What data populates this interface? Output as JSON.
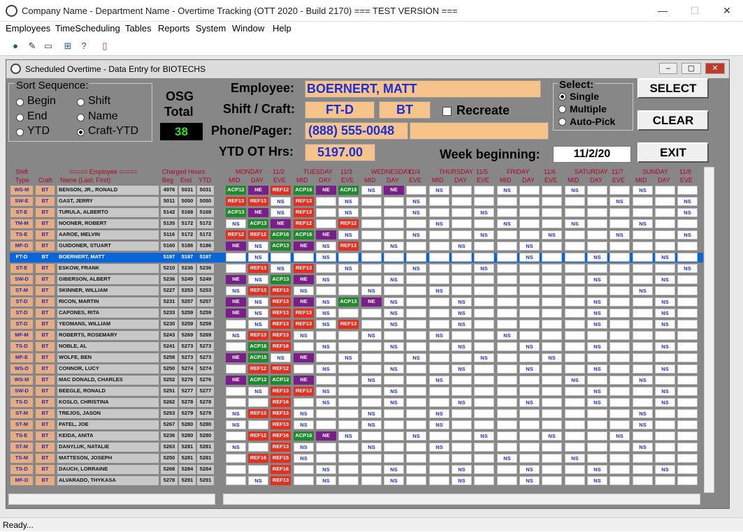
{
  "window": {
    "title": "Company Name - Department Name - Overtime Tracking (OTT 2020 - Build 2170)  === TEST VERSION ===",
    "min": "—",
    "max": "☐",
    "close": "✕"
  },
  "menu": [
    "Employees",
    "TimeScheduling",
    "Tables",
    "Reports",
    "System",
    "Window",
    "Help"
  ],
  "toolbar": [
    "db-icon",
    "pencil-icon",
    "print-icon",
    "grid-icon",
    "help-icon",
    "exit-door-icon"
  ],
  "child": {
    "title": "Scheduled Overtime - Data Entry for BIOTECHS"
  },
  "sort": {
    "title": "Sort Sequence:",
    "options": [
      "Begin",
      "Shift",
      "End",
      "Name",
      "YTD",
      "Craft-YTD"
    ],
    "selected": "Craft-YTD"
  },
  "osg": {
    "label1": "OSG",
    "label2": "Total",
    "value": "38"
  },
  "employee": {
    "label": "Employee:",
    "value": "BOERNERT, MATT"
  },
  "shift": {
    "label": "Shift / Craft:",
    "shift": "FT-D",
    "craft": "BT",
    "recreate": "Recreate"
  },
  "phone": {
    "label": "Phone/Pager:",
    "value": "(888) 555-0048",
    "pager": ""
  },
  "ytd": {
    "label": "YTD OT Hrs:",
    "value": "5197.00"
  },
  "week": {
    "label": "Week beginning:",
    "value": "11/2/20"
  },
  "select": {
    "title": "Select:",
    "options": [
      "Single",
      "Multiple",
      "Auto-Pick"
    ],
    "selected": "Single"
  },
  "buttons": {
    "select": "SELECT",
    "clear": "CLEAR",
    "exit": "EXIT"
  },
  "grid": {
    "hdr": {
      "shift": "Shift",
      "type": "Type",
      "craft": "Craft",
      "emp": "===== Employee =====",
      "name": "Name (Last, First)",
      "charged": "Charged Hours",
      "beg": "Beg",
      "end": "End",
      "ytd": "YTD"
    },
    "days": [
      {
        "d": "MONDAY",
        "dt": "11/2"
      },
      {
        "d": "TUESDAY",
        "dt": "11/3"
      },
      {
        "d": "WEDNESDAY",
        "dt": "11/4"
      },
      {
        "d": "THURSDAY",
        "dt": "11/5"
      },
      {
        "d": "FRIDAY",
        "dt": "11/6"
      },
      {
        "d": "SATURDAY",
        "dt": "11/7"
      },
      {
        "d": "SUNDAY",
        "dt": "11/8"
      }
    ],
    "sub": [
      "MID",
      "DAY",
      "EVE"
    ],
    "rows": [
      [
        "WS-M",
        "BT",
        "BENSON, JR., RONALD",
        "4976",
        "5031",
        "5031",
        "ACP12",
        "NE",
        "REF12",
        "ACP16",
        "NE",
        "ACP15",
        "NS",
        "NE",
        "",
        "NS",
        "",
        "",
        "NS",
        "",
        "",
        "NS",
        "",
        "",
        "NS",
        "",
        ""
      ],
      [
        "SW-E",
        "BT",
        "GAST, JERRY",
        "5011",
        "5050",
        "5050",
        "REF13",
        "REF13",
        "NS",
        "REF13",
        "",
        "NS",
        "",
        "",
        "NS",
        "",
        "",
        "",
        "",
        "",
        "",
        "",
        "",
        "NS",
        "",
        "",
        "NS"
      ],
      [
        "ST-E",
        "BT",
        "TURULA, ALBERTO",
        "5142",
        "5168",
        "5168",
        "ACP13",
        "NE",
        "NS",
        "REF13",
        "",
        "NS",
        "",
        "",
        "NS",
        "",
        "",
        "NS",
        "",
        "",
        "",
        "",
        "",
        "",
        "",
        "",
        "NS"
      ],
      [
        "TM-M",
        "BT",
        "NOONER, ROBERT",
        "5135",
        "5172",
        "5172",
        "NS",
        "ACP13",
        "NE",
        "REF12",
        "",
        "REF12",
        "",
        "",
        "",
        "NS",
        "",
        "",
        "NS",
        "",
        "",
        "NS",
        "",
        "",
        "NS",
        "",
        ""
      ],
      [
        "TS-E",
        "BT",
        "AAROE, MELVIN",
        "5116",
        "5172",
        "5172",
        "REF12",
        "REF12",
        "ACP16",
        "ACP16",
        "NE",
        "NS",
        "",
        "",
        "NS",
        "",
        "",
        "NS",
        "",
        "",
        "NS",
        "",
        "",
        "NS",
        "",
        "",
        "NS"
      ],
      [
        "MF-D",
        "BT",
        "GUIDONER, STUART",
        "5160",
        "5186",
        "5186",
        "NE",
        "NS",
        "ACP13",
        "NE",
        "NS",
        "REF13",
        "",
        "NS",
        "",
        "",
        "NS",
        "",
        "",
        "NS",
        "",
        "",
        "",
        "",
        "",
        "",
        ""
      ],
      [
        "FT-D",
        "BT",
        "BOERNERT, MATT",
        "5197",
        "5197",
        "5197",
        "",
        "NS",
        "",
        "",
        "NS",
        "",
        "",
        "",
        "",
        "",
        "",
        "",
        "",
        "NS",
        "",
        "",
        "NS",
        "",
        "",
        "NS",
        ""
      ],
      [
        "ST-E",
        "BT",
        "ESKOW, FRANK",
        "5210",
        "5236",
        "5236",
        "",
        "REF13",
        "NS",
        "REF13",
        "",
        "NS",
        "",
        "",
        "NS",
        "",
        "",
        "NS",
        "",
        "",
        "",
        "",
        "",
        "",
        "",
        "",
        "NS"
      ],
      [
        "SW-D",
        "BT",
        "GIBERSON, ALBERT",
        "5236",
        "5249",
        "5249",
        "NE",
        "NS",
        "ACP13",
        "NE",
        "NS",
        "",
        "",
        "NS",
        "",
        "",
        "",
        "",
        "",
        "",
        "",
        "",
        "NS",
        "",
        "",
        "NS",
        ""
      ],
      [
        "ST-M",
        "BT",
        "SKINNER, WILLIAM",
        "5227",
        "5253",
        "5253",
        "NS",
        "REF13",
        "REF13",
        "NS",
        "",
        "",
        "NS",
        "",
        "",
        "NS",
        "",
        "",
        "",
        "",
        "",
        "",
        "",
        "",
        "NS",
        "",
        ""
      ],
      [
        "ST-D",
        "BT",
        "RICON, MARTIN",
        "5231",
        "5257",
        "5257",
        "NE",
        "NS",
        "REF13",
        "NE",
        "NS",
        "ACP13",
        "NE",
        "NS",
        "",
        "",
        "NS",
        "",
        "",
        "",
        "",
        "",
        "NS",
        "",
        "",
        "NS",
        ""
      ],
      [
        "ST-D",
        "BT",
        "CAPONES, RITA",
        "5233",
        "5259",
        "5259",
        "NE",
        "NS",
        "REF13",
        "REF13",
        "NS",
        "",
        "",
        "NS",
        "",
        "",
        "NS",
        "",
        "",
        "",
        "",
        "",
        "NS",
        "",
        "",
        "NS",
        ""
      ],
      [
        "ST-D",
        "BT",
        "YEOMANS, WILLIAM",
        "5230",
        "5259",
        "5259",
        "",
        "NS",
        "REF13",
        "REF13",
        "NS",
        "REF13",
        "",
        "NS",
        "",
        "",
        "NS",
        "",
        "",
        "",
        "",
        "",
        "NS",
        "",
        "",
        "NS",
        ""
      ],
      [
        "MF-M",
        "BT",
        "ROBERTS, ROSEMARY",
        "5243",
        "5269",
        "5269",
        "NS",
        "REF13",
        "REF13",
        "NS",
        "",
        "",
        "NS",
        "",
        "",
        "NS",
        "",
        "",
        "NS",
        "",
        "",
        "",
        "",
        "",
        "",
        "",
        ""
      ],
      [
        "TS-D",
        "BT",
        "NOBLE, AL",
        "5241",
        "5273",
        "5273",
        "",
        "ACP16",
        "REF16",
        "",
        "NS",
        "",
        "",
        "NS",
        "",
        "",
        "NS",
        "",
        "",
        "NS",
        "",
        "",
        "NS",
        "",
        "",
        "NS",
        ""
      ],
      [
        "MF-E",
        "BT",
        "WOLFE, BEN",
        "5258",
        "5273",
        "5273",
        "NE",
        "ACP15",
        "NS",
        "NE",
        "",
        "NS",
        "",
        "",
        "NS",
        "",
        "",
        "NS",
        "",
        "",
        "NS",
        "",
        "",
        "",
        "",
        "",
        ""
      ],
      [
        "WS-D",
        "BT",
        "CONNOR, LUCY",
        "5250",
        "5274",
        "5274",
        "",
        "REF12",
        "REF12",
        "",
        "NS",
        "",
        "",
        "NS",
        "",
        "",
        "NS",
        "",
        "",
        "NS",
        "",
        "",
        "NS",
        "",
        "",
        "NS",
        ""
      ],
      [
        "WS-M",
        "BT",
        "MAC DONALD, CHARLES",
        "5252",
        "5276",
        "5276",
        "NE",
        "ACP12",
        "ACP12",
        "NE",
        "",
        "",
        "NS",
        "",
        "",
        "NS",
        "",
        "",
        "",
        "",
        "",
        "NS",
        "",
        "",
        "NS",
        "",
        ""
      ],
      [
        "SW-D",
        "BT",
        "BEEGLE, RONALD",
        "5251",
        "5277",
        "5277",
        "",
        "NS",
        "REF13",
        "REF13",
        "NS",
        "",
        "",
        "NS",
        "",
        "",
        "",
        "",
        "",
        "",
        "",
        "",
        "NS",
        "",
        "",
        "NS",
        ""
      ],
      [
        "TS-D",
        "BT",
        "KOSLO, CHRISTINA",
        "5262",
        "5278",
        "5278",
        "",
        "",
        "REF16",
        "",
        "NS",
        "",
        "",
        "NS",
        "",
        "",
        "NS",
        "",
        "",
        "NS",
        "",
        "",
        "NS",
        "",
        "",
        "NS",
        ""
      ],
      [
        "ST-M",
        "BT",
        "TREJOS, JASON",
        "5253",
        "5279",
        "5279",
        "NS",
        "REF13",
        "REF13",
        "NS",
        "",
        "",
        "NS",
        "",
        "",
        "NS",
        "",
        "",
        "",
        "",
        "",
        "",
        "",
        "",
        "NS",
        "",
        ""
      ],
      [
        "ST-M",
        "BT",
        "PATEL, JOE",
        "5267",
        "5280",
        "5280",
        "NS",
        "",
        "REF13",
        "NS",
        "",
        "",
        "NS",
        "",
        "",
        "NS",
        "",
        "",
        "",
        "",
        "",
        "",
        "",
        "",
        "NS",
        "",
        ""
      ],
      [
        "TS-E",
        "BT",
        "KEIDA, ANITA",
        "5236",
        "5280",
        "5280",
        "",
        "REF12",
        "REF16",
        "ACP16",
        "NE",
        "NS",
        "",
        "",
        "NS",
        "",
        "",
        "NS",
        "",
        "",
        "NS",
        "",
        "",
        "NS",
        "",
        "",
        ""
      ],
      [
        "ST-M",
        "BT",
        "DANYLUK, NATALIE",
        "5263",
        "5281",
        "5281",
        "NS",
        "",
        "REF13",
        "NS",
        "",
        "",
        "NS",
        "",
        "",
        "NS",
        "",
        "",
        "",
        "",
        "",
        "",
        "",
        "",
        "NS",
        "",
        ""
      ],
      [
        "TS-M",
        "BT",
        "MATTESON, JOSEPH",
        "5250",
        "5281",
        "5281",
        "",
        "REF16",
        "REF15",
        "NS",
        "",
        "",
        "",
        "",
        "",
        "",
        "",
        "",
        "NS",
        "",
        "",
        "NS",
        "",
        "",
        "",
        "",
        ""
      ],
      [
        "TS-D",
        "BT",
        "DAUCH, LORRAINE",
        "5268",
        "5284",
        "5284",
        "",
        "",
        "REF16",
        "",
        "NS",
        "",
        "",
        "NS",
        "",
        "",
        "NS",
        "",
        "",
        "NS",
        "",
        "",
        "NS",
        "",
        "",
        "NS",
        ""
      ],
      [
        "MF-D",
        "BT",
        "ALVARADO, THYKASA",
        "5278",
        "5291",
        "5291",
        "",
        "NS",
        "REF13",
        "",
        "NS",
        "",
        "",
        "NS",
        "",
        "",
        "NS",
        "",
        "",
        "NS",
        "",
        "",
        "NS",
        "",
        "",
        "",
        ""
      ]
    ],
    "selectedRow": 6
  },
  "status": "Ready..."
}
